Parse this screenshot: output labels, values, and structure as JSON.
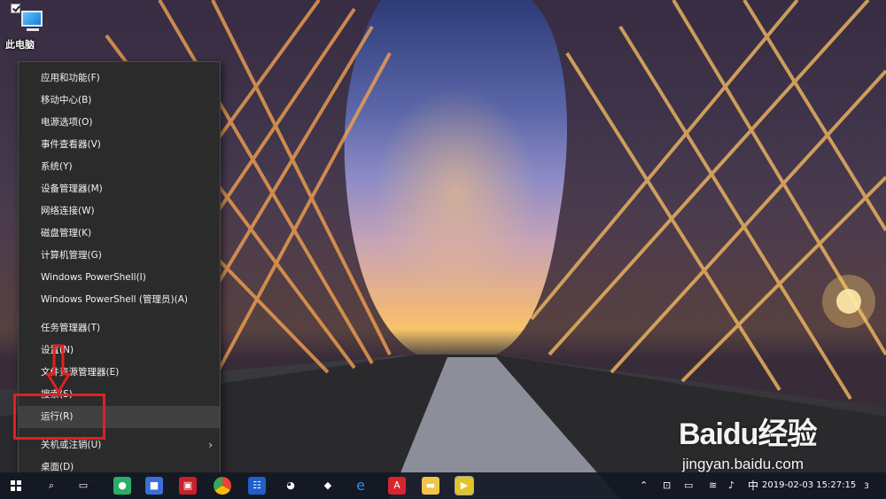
{
  "desktop": {
    "icons": [
      {
        "label": "此电脑",
        "icon": "this-pc-icon"
      }
    ]
  },
  "winx_menu": {
    "items": [
      {
        "label": "应用和功能(F)"
      },
      {
        "label": "移动中心(B)"
      },
      {
        "label": "电源选项(O)"
      },
      {
        "label": "事件查看器(V)"
      },
      {
        "label": "系统(Y)"
      },
      {
        "label": "设备管理器(M)"
      },
      {
        "label": "网络连接(W)"
      },
      {
        "label": "磁盘管理(K)"
      },
      {
        "label": "计算机管理(G)"
      },
      {
        "label": "Windows PowerShell(I)"
      },
      {
        "label": "Windows PowerShell (管理员)(A)"
      },
      {
        "label": "任务管理器(T)"
      },
      {
        "label": "设置(N)"
      },
      {
        "label": "文件资源管理器(E)"
      },
      {
        "label": "搜索(S)"
      },
      {
        "label": "运行(R)",
        "highlighted": true
      },
      {
        "label": "关机或注销(U)",
        "has_submenu": true
      },
      {
        "label": "桌面(D)"
      }
    ]
  },
  "taskbar": {
    "pinned_icons": [
      "task-view-icon",
      "wechat-icon",
      "app-icon",
      "app-icon",
      "chrome-icon",
      "app-icon",
      "qq-icon",
      "app-icon",
      "ie-icon",
      "app-icon",
      "file-explorer-icon",
      "app-icon"
    ],
    "tray": {
      "ime": "中",
      "datetime": "2019-02-03  15:27:15",
      "notification_count": "3"
    }
  },
  "watermark": {
    "brand": "Baidu经验",
    "url": "jingyan.baidu.com"
  },
  "colors": {
    "menu_bg": "#2b2b2b",
    "menu_hover": "#414141",
    "annotation_red": "#e02020"
  }
}
